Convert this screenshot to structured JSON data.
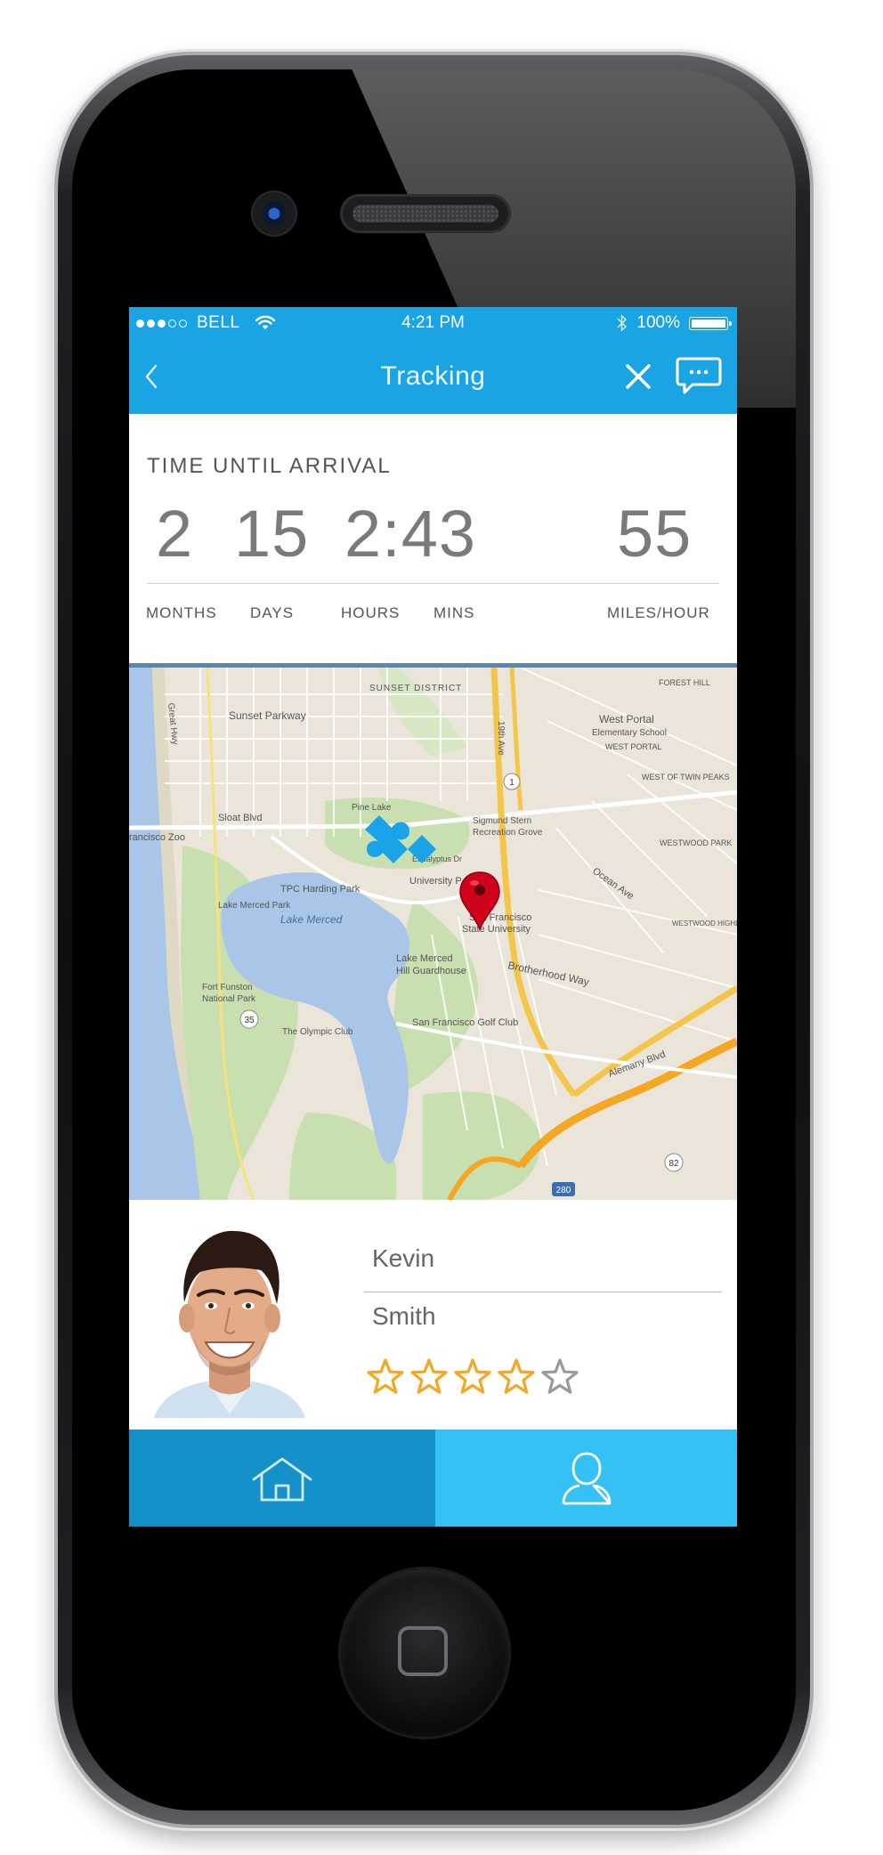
{
  "status_bar": {
    "carrier": "BELL",
    "time": "4:21 PM",
    "battery": "100%"
  },
  "nav": {
    "title": "Tracking"
  },
  "eta": {
    "heading": "TIME UNTIL ARRIVAL",
    "months": "2",
    "days": "15",
    "hours_mins": "2:43",
    "speed": "55",
    "labels": {
      "months": "MONTHS",
      "days": "DAYS",
      "hours": "HOURS",
      "mins": "MINS",
      "speed": "MILES/HOUR"
    }
  },
  "map": {
    "labels": {
      "sunset_district": "SUNSET DISTRICT",
      "sunset_parkway": "Sunset Parkway",
      "forest_hill": "FOREST HILL",
      "west_portal": "West Portal",
      "west_portal_school": "Elementary School",
      "west_portal_area": "WEST PORTAL",
      "west_twin_peaks": "WEST OF TWIN PEAKS",
      "westwood_park": "WESTWOOD PARK",
      "westwood_highlands": "WESTWOOD HIGHLANDS",
      "zoo": "rancisco Zoo",
      "pine_lake": "Pine Lake",
      "sigmund_stern": "Sigmund Stern",
      "recreation_grove": "Recreation Grove",
      "eucalyptus": "Eucalyptus Dr",
      "tpc": "TPC Harding Park",
      "lake_merced_park": "Lake Merced Park",
      "lake_merced": "Lake Merced",
      "university_park": "University P",
      "sfsu_1": "San Francisco",
      "sfsu_2": "State University",
      "fort_funston_1": "Fort Funston",
      "fort_funston_2": "National Park",
      "olympic_club": "The Olympic Club",
      "hill_guardhouse_1": "Lake Merced",
      "hill_guardhouse_2": "Hill Guardhouse",
      "brotherhood_way": "Brotherhood Way",
      "golf_club": "San Francisco Golf Club",
      "ave_19": "19th Ave",
      "sloat": "Sloat Blvd",
      "ocean_ave": "Ocean Ave",
      "alemany": "Alemany Blvd",
      "great_hwy": "Great Hwy",
      "highway_1": "1",
      "highway_35": "35",
      "highway_280": "280",
      "highway_82": "82"
    }
  },
  "driver": {
    "first_name": "Kevin",
    "last_name": "Smith",
    "rating": 4,
    "rating_max": 5
  },
  "colors": {
    "primary": "#1ba4e3",
    "tab_home": "#1591c9",
    "tab_profile": "#34c1f4",
    "star": "#f5a623",
    "star_empty": "#9a9a9a",
    "pin": "#d0021b"
  },
  "icons": {
    "back": "chevron-left-icon",
    "close": "close-icon",
    "chat": "chat-bubble-icon",
    "home": "home-icon",
    "profile": "user-icon"
  }
}
